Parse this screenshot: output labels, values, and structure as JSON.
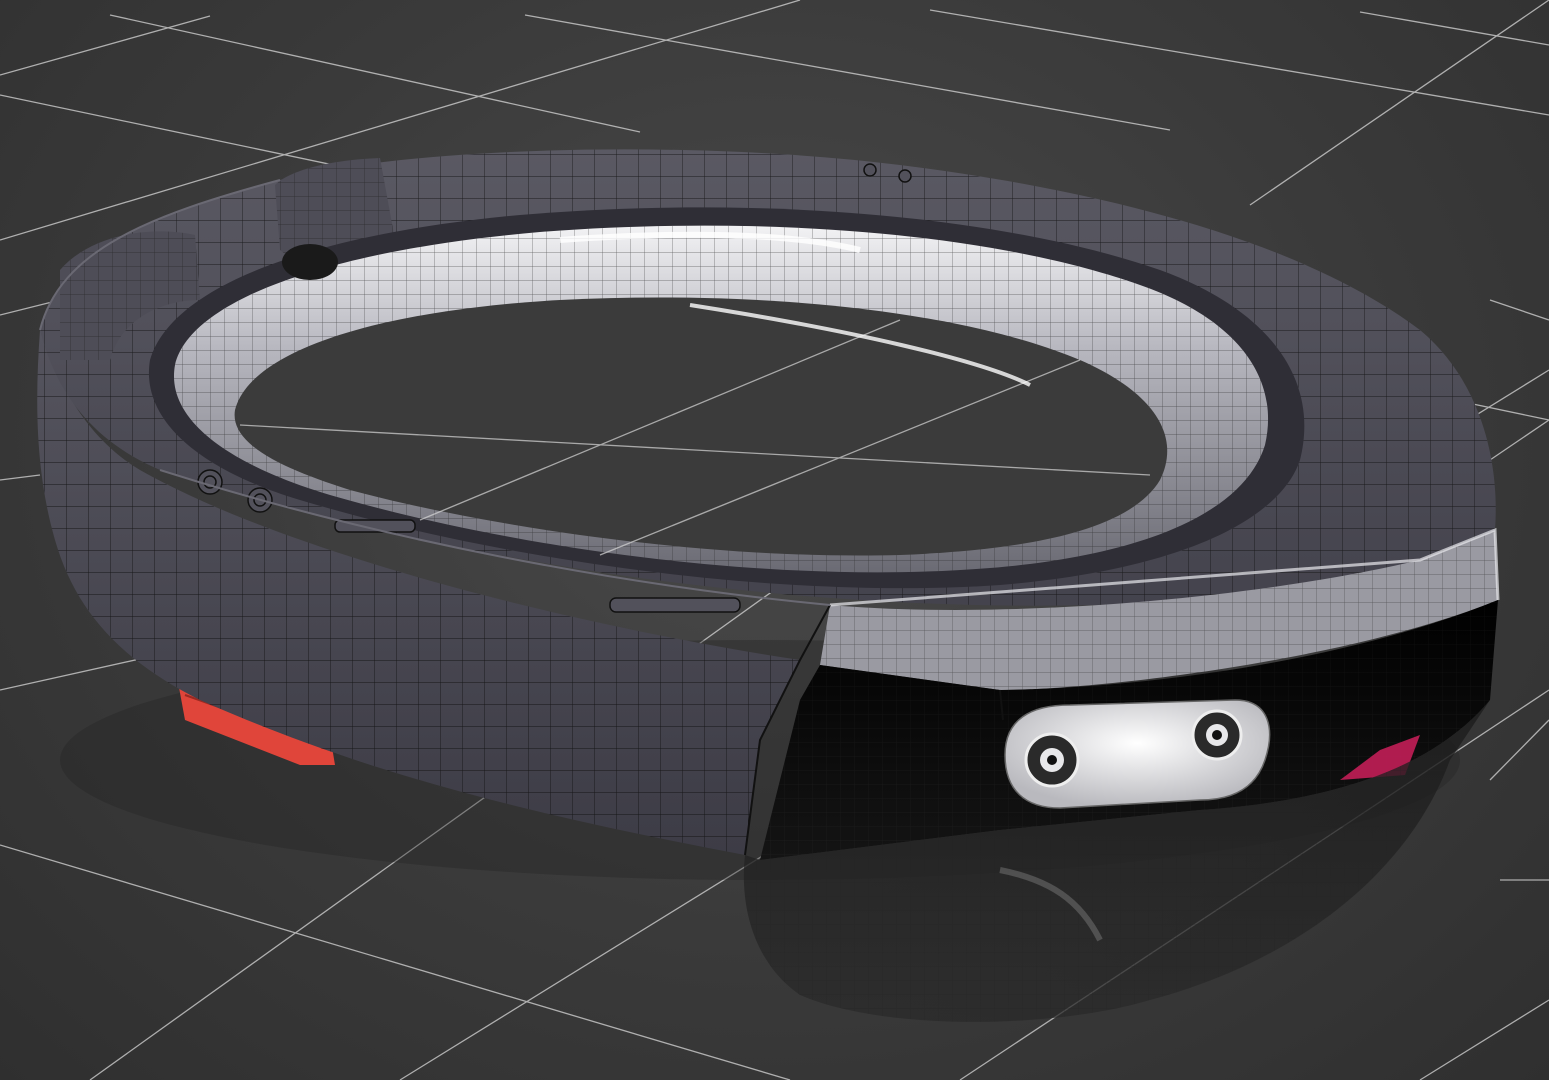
{
  "viewport": {
    "background": "#3a3a3a",
    "grid_color": "#d8d8d8"
  },
  "model": {
    "shell_color": "#4b4a55",
    "band_color": "#9e9ea6",
    "band_highlight": "#e9e9ee",
    "visor_color": "#050505",
    "sensor_color": "#d4d4d8",
    "vent_color": "#e0453a",
    "wire_color": "#111111",
    "accent_color": "#c21e56"
  }
}
